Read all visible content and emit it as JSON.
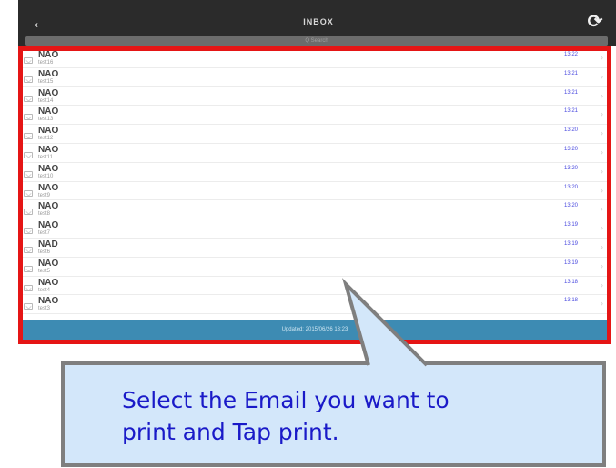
{
  "nav": {
    "title": "INBOX",
    "back_icon": "arrow-left-icon",
    "refresh_icon": "refresh-icon",
    "search_placeholder": "Q Search"
  },
  "emails": [
    {
      "sender": "NAO",
      "subject": "test16",
      "time": "13:22"
    },
    {
      "sender": "NAO",
      "subject": "test15",
      "time": "13:21"
    },
    {
      "sender": "NAO",
      "subject": "test14",
      "time": "13:21"
    },
    {
      "sender": "NAO",
      "subject": "test13",
      "time": "13:21"
    },
    {
      "sender": "NAO",
      "subject": "test12",
      "time": "13:20"
    },
    {
      "sender": "NAO",
      "subject": "test11",
      "time": "13:20"
    },
    {
      "sender": "NAO",
      "subject": "test10",
      "time": "13:20"
    },
    {
      "sender": "NAO",
      "subject": "test9",
      "time": "13:20"
    },
    {
      "sender": "NAO",
      "subject": "test8",
      "time": "13:20"
    },
    {
      "sender": "NAO",
      "subject": "test7",
      "time": "13:19"
    },
    {
      "sender": "NAD",
      "subject": "test6",
      "time": "13:19"
    },
    {
      "sender": "NAO",
      "subject": "test5",
      "time": "13:19"
    },
    {
      "sender": "NAO",
      "subject": "test4",
      "time": "13:18"
    },
    {
      "sender": "NAO",
      "subject": "test3",
      "time": "13:18"
    }
  ],
  "status": {
    "text": "Updated: 2015/06/26 13:23"
  },
  "callout": {
    "line1": "Select the Email you want to",
    "line2": "print and Tap print."
  },
  "colors": {
    "highlight": "#e51515",
    "callout_fill": "#d3e7fa",
    "callout_text": "#1a1ac8",
    "status_bar": "#3d8bb3"
  }
}
